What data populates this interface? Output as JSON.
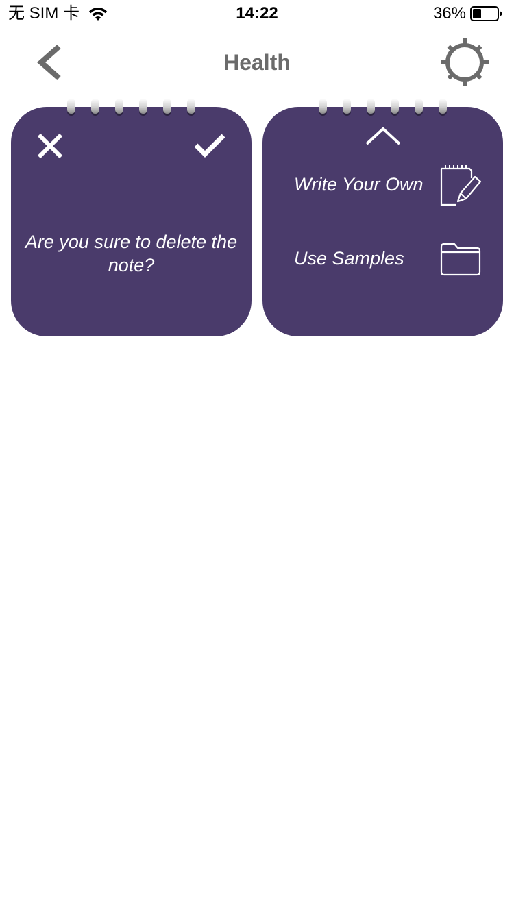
{
  "status_bar": {
    "carrier": "无 SIM 卡",
    "time": "14:22",
    "battery_percent": "36%",
    "battery_level": 0.36,
    "wifi_icon": "wifi-icon",
    "battery_icon": "battery-icon"
  },
  "nav": {
    "title": "Health",
    "back_icon": "chevron-left-icon",
    "settings_icon": "gear-icon",
    "title_color": "#6b6b6b"
  },
  "delete_card": {
    "close_icon": "close-icon",
    "confirm_icon": "checkmark-icon",
    "message": "Are you sure to delete the note?"
  },
  "add_card": {
    "collapse_icon": "chevron-up-icon",
    "options": [
      {
        "label": "Write Your Own",
        "icon": "note-pencil-icon"
      },
      {
        "label": "Use Samples",
        "icon": "folder-icon"
      }
    ]
  },
  "colors": {
    "card_background": "#4a3b6b",
    "card_text": "#ffffff",
    "page_background": "#ffffff"
  }
}
